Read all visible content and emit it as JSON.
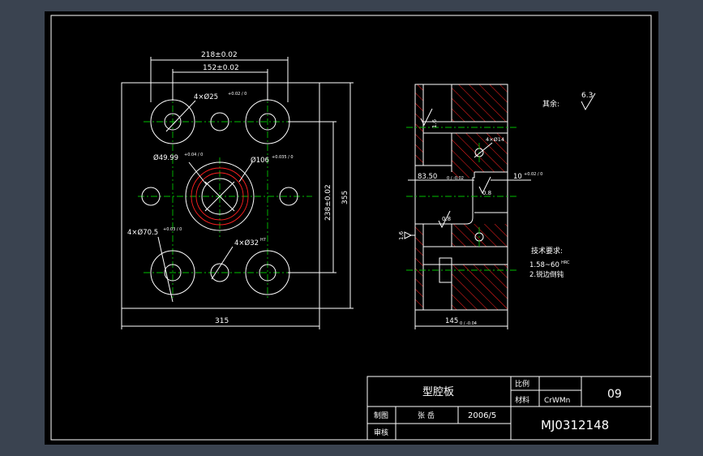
{
  "title_block": {
    "part_name": "型腔板",
    "scale_label": "比例",
    "material_label": "材料",
    "material_value": "CrWMn",
    "sheet_no": "09",
    "drawn_label": "制图",
    "drawn_by": "张 岳",
    "date": "2006/5",
    "checked_label": "审核",
    "drawing_code": "MJ0312148"
  },
  "front_view": {
    "dim_218": "218±0.02",
    "dim_152": "152±0.02",
    "hole_25": "4×Ø25",
    "hole_25_tol": "+0.02 / 0",
    "hole_49": "Ø49.99",
    "hole_49_tol": "+0.04 / 0",
    "hole_106": "Ø106",
    "hole_106_tol": "+0.035 / 0",
    "hole_70": "4×Ø70.5",
    "hole_70_tol": "+0.03 / 0",
    "hole_32": "4×Ø32",
    "hole_32_tol": "H7",
    "dim_238": "238±0.02",
    "dim_355": "355",
    "dim_315": "315"
  },
  "section_view": {
    "rough_1": "1.6",
    "rough_2": "1.6",
    "rough_3": "0.8",
    "rough_4": "0.8",
    "hole_14": "4×Ø14",
    "dim_83": "83.50",
    "dim_83_tol": "0 / -0.02",
    "dim_10": "10",
    "dim_10_tol": "+0.02 / 0",
    "dim_145": "145",
    "dim_145_tol": "0 / -0.04"
  },
  "notes": {
    "other_label": "其余:",
    "other_value": "6.3",
    "tech_title": "技术要求:",
    "tech_1": "1.58~60",
    "tech_1_unit": "HRC",
    "tech_2": "2.锐边倒钝"
  },
  "colors": {
    "background": "#3a4350",
    "drawing_bg": "#000000",
    "line": "#ffffff",
    "center_line": "#00c000",
    "hatch": "#ff2020"
  }
}
